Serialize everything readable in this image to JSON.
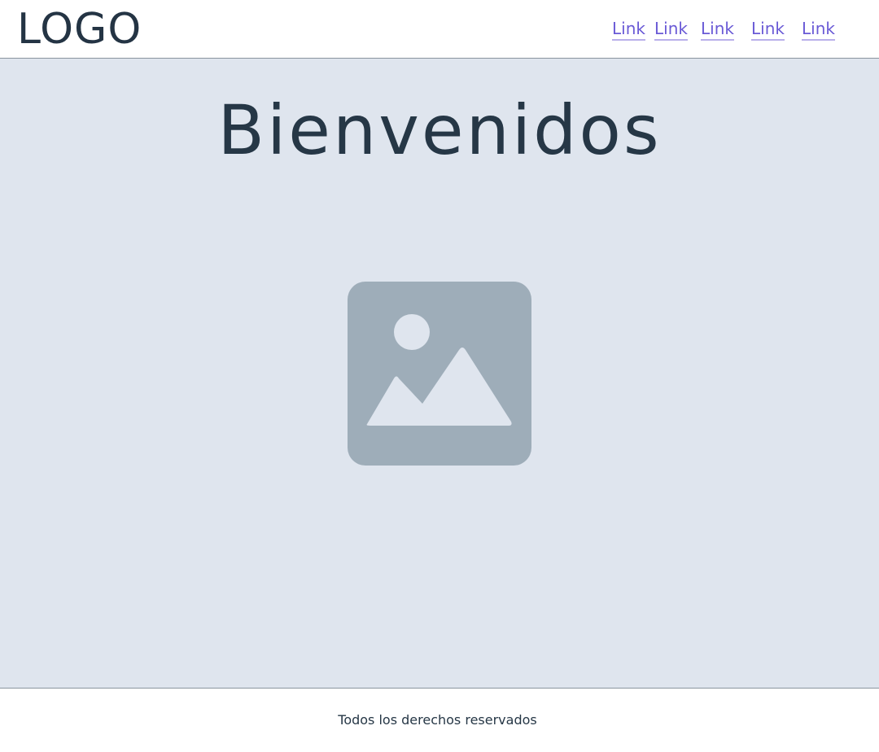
{
  "header": {
    "logo": "LOGO",
    "nav_links": [
      "Link",
      "Link",
      "Link",
      "Link",
      "Link"
    ]
  },
  "main": {
    "title": "Bienvenidos",
    "image_icon": "image-placeholder-icon"
  },
  "footer": {
    "text": "Todos los derechos reservados"
  },
  "colors": {
    "header_bg": "#ffffff",
    "main_bg": "#dfe5ee",
    "text": "#263746",
    "link": "#6a5ad6",
    "link_underline": "#b9b0ea",
    "placeholder": "#9eadb9"
  }
}
